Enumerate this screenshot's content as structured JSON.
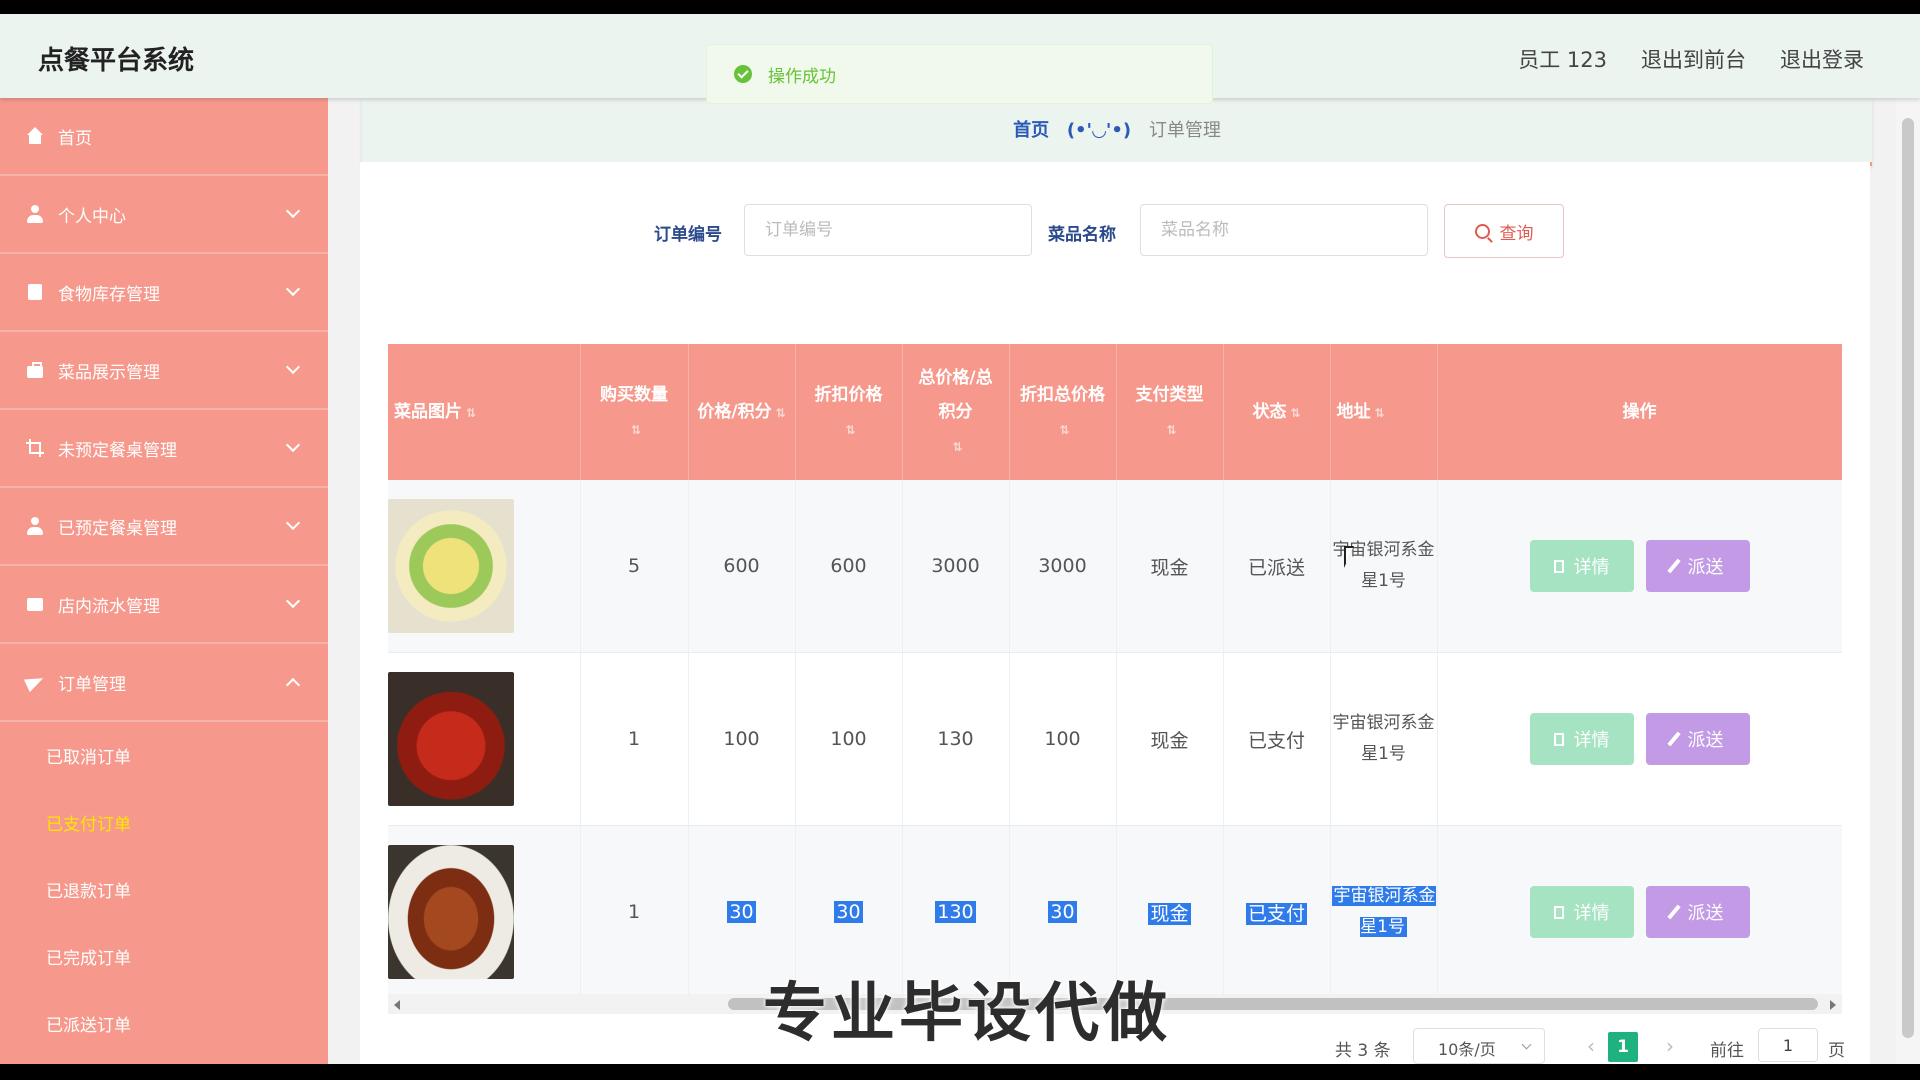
{
  "header": {
    "app_title": "点餐平台系统",
    "user": "员工 123",
    "back_front": "退出到前台",
    "logout": "退出登录"
  },
  "toast": {
    "message": "操作成功"
  },
  "sidebar": {
    "items": [
      {
        "label": "首页",
        "icon": "home-icon"
      },
      {
        "label": "个人中心",
        "icon": "user-icon"
      },
      {
        "label": "食物库存管理",
        "icon": "clipboard-icon"
      },
      {
        "label": "菜品展示管理",
        "icon": "briefcase-icon"
      },
      {
        "label": "未预定餐桌管理",
        "icon": "crop-icon"
      },
      {
        "label": "已预定餐桌管理",
        "icon": "user-icon"
      },
      {
        "label": "店内流水管理",
        "icon": "wallet-icon"
      },
      {
        "label": "订单管理",
        "icon": "paper-plane-icon"
      }
    ],
    "sub_items": [
      {
        "label": "已取消订单"
      },
      {
        "label": "已支付订单",
        "active": true
      },
      {
        "label": "已退款订单"
      },
      {
        "label": "已完成订单"
      },
      {
        "label": "已派送订单"
      }
    ]
  },
  "breadcrumb": {
    "home": "首页",
    "separator": "(•'◡'•)",
    "current": "订单管理"
  },
  "search": {
    "order_no_label": "订单编号",
    "order_no_placeholder": "订单编号",
    "dish_name_label": "菜品名称",
    "dish_name_placeholder": "菜品名称",
    "query_label": "查询"
  },
  "table": {
    "headers": [
      "菜品图片",
      "购买数量",
      "价格/积分",
      "折扣价格",
      "总价格/总积分",
      "折扣总价格",
      "支付类型",
      "状态",
      "地址",
      "操作"
    ],
    "rows": [
      {
        "image": "dish-egg-pepper-image",
        "qty": "5",
        "price": "600",
        "discount_price": "600",
        "total": "3000",
        "discount_total": "3000",
        "pay_type": "现金",
        "status": "已派送",
        "address": "宇宙银河系金星1号"
      },
      {
        "image": "dish-crayfish-image",
        "qty": "1",
        "price": "100",
        "discount_price": "100",
        "total": "130",
        "discount_total": "100",
        "pay_type": "现金",
        "status": "已支付",
        "address": "宇宙银河系金星1号"
      },
      {
        "image": "dish-braised-fish-image",
        "qty": "1",
        "price": "30",
        "discount_price": "30",
        "total": "130",
        "discount_total": "30",
        "pay_type": "现金",
        "status": "已支付",
        "address": "宇宙银河系金星1号"
      }
    ],
    "detail_label": "详情",
    "dispatch_label": "派送"
  },
  "pagination": {
    "total": "共 3 条",
    "page_size": "10条/页",
    "current_page": "1",
    "goto_label": "前往",
    "goto_value": "1",
    "page_suffix": "页"
  },
  "watermark": "专业毕设代做",
  "colors": {
    "sidebar": "#f6998c",
    "header": "#ecf4ef",
    "success": "#67c23a",
    "detail_btn": "#a6e3c3",
    "dispatch_btn": "#c39ae6",
    "active_page": "#1fb27f",
    "active_menu_text": "#ffe600",
    "selection": "#2f7bea"
  }
}
